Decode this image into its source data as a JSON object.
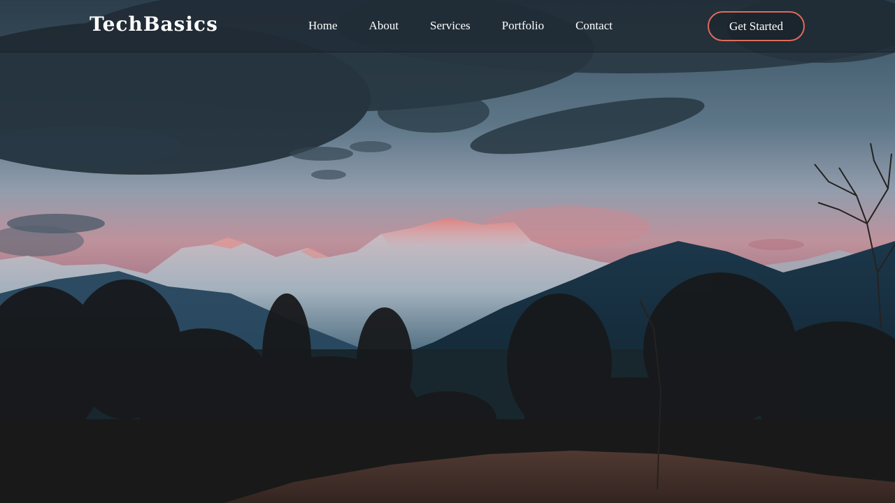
{
  "brand": {
    "name": "TechBasics"
  },
  "nav": {
    "items": [
      {
        "label": "Home"
      },
      {
        "label": "About"
      },
      {
        "label": "Services"
      },
      {
        "label": "Portfolio"
      },
      {
        "label": "Contact"
      }
    ]
  },
  "cta": {
    "label": "Get Started"
  },
  "colors": {
    "accent": "#e06a5a",
    "nav_text": "#ffffff",
    "sky_top": "#4d6b80",
    "sky_bottom": "#d89aa2"
  },
  "hero_image": {
    "icon": "mountain-landscape-image"
  }
}
